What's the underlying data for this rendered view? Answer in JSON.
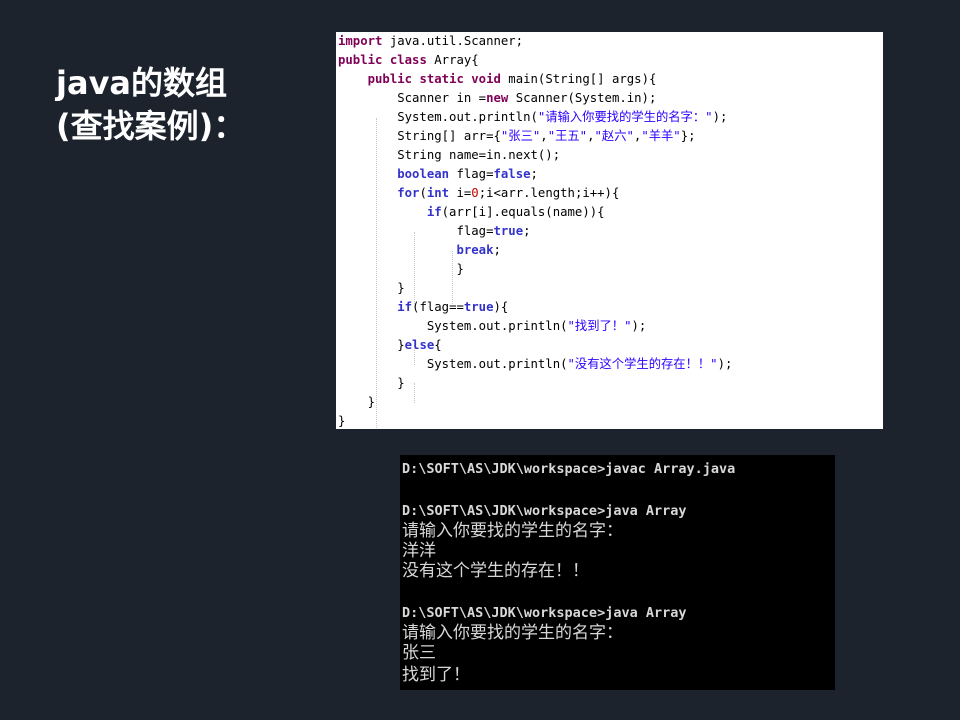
{
  "slide": {
    "title_line1": "java的数组",
    "title_line2": "(查找案例)："
  },
  "code": {
    "lines": [
      [
        {
          "t": "import",
          "c": "kw"
        },
        {
          "t": " java.util.Scanner;",
          "c": "pl"
        }
      ],
      [
        {
          "t": "public",
          "c": "kw"
        },
        {
          "t": " ",
          "c": "pl"
        },
        {
          "t": "class",
          "c": "kw"
        },
        {
          "t": " Array{",
          "c": "pl"
        }
      ],
      [
        {
          "t": "    ",
          "c": "pl"
        },
        {
          "t": "public",
          "c": "kw"
        },
        {
          "t": " ",
          "c": "pl"
        },
        {
          "t": "static",
          "c": "kw"
        },
        {
          "t": " ",
          "c": "pl"
        },
        {
          "t": "void",
          "c": "kw"
        },
        {
          "t": " main(String[] args){",
          "c": "pl"
        }
      ],
      [
        {
          "t": "        Scanner in =",
          "c": "pl"
        },
        {
          "t": "new",
          "c": "kw"
        },
        {
          "t": " Scanner(System.in);",
          "c": "pl"
        }
      ],
      [
        {
          "t": "        System.out.println(",
          "c": "pl"
        },
        {
          "t": "\"请输入你要找的学生的名字：\"",
          "c": "str"
        },
        {
          "t": ");",
          "c": "pl"
        }
      ],
      [
        {
          "t": "        String[] arr={",
          "c": "pl"
        },
        {
          "t": "\"张三\"",
          "c": "str"
        },
        {
          "t": ",",
          "c": "pl"
        },
        {
          "t": "\"王五\"",
          "c": "str"
        },
        {
          "t": ",",
          "c": "pl"
        },
        {
          "t": "\"赵六\"",
          "c": "str"
        },
        {
          "t": ",",
          "c": "pl"
        },
        {
          "t": "\"羊羊\"",
          "c": "str"
        },
        {
          "t": "};",
          "c": "pl"
        }
      ],
      [
        {
          "t": "        String name=in.next();",
          "c": "pl"
        }
      ],
      [
        {
          "t": "        ",
          "c": "pl"
        },
        {
          "t": "boolean",
          "c": "kb"
        },
        {
          "t": " flag=",
          "c": "pl"
        },
        {
          "t": "false",
          "c": "kb"
        },
        {
          "t": ";",
          "c": "pl"
        }
      ],
      [
        {
          "t": "        ",
          "c": "pl"
        },
        {
          "t": "for",
          "c": "kb"
        },
        {
          "t": "(",
          "c": "pl"
        },
        {
          "t": "int",
          "c": "kb"
        },
        {
          "t": " i=",
          "c": "pl"
        },
        {
          "t": "0",
          "c": "num"
        },
        {
          "t": ";i<arr.length;i++){",
          "c": "pl"
        }
      ],
      [
        {
          "t": "            ",
          "c": "pl"
        },
        {
          "t": "if",
          "c": "kb"
        },
        {
          "t": "(arr[i].equals(name)){",
          "c": "pl"
        }
      ],
      [
        {
          "t": "                flag=",
          "c": "pl"
        },
        {
          "t": "true",
          "c": "kb"
        },
        {
          "t": ";",
          "c": "pl"
        }
      ],
      [
        {
          "t": "                ",
          "c": "pl"
        },
        {
          "t": "break",
          "c": "kb"
        },
        {
          "t": ";",
          "c": "pl"
        }
      ],
      [
        {
          "t": "                }",
          "c": "pl"
        }
      ],
      [
        {
          "t": "        }",
          "c": "pl"
        }
      ],
      [
        {
          "t": "        ",
          "c": "pl"
        },
        {
          "t": "if",
          "c": "kb"
        },
        {
          "t": "(flag==",
          "c": "pl"
        },
        {
          "t": "true",
          "c": "kb"
        },
        {
          "t": "){",
          "c": "pl"
        }
      ],
      [
        {
          "t": "            System.out.println(",
          "c": "pl"
        },
        {
          "t": "\"找到了！\"",
          "c": "str"
        },
        {
          "t": ");",
          "c": "pl"
        }
      ],
      [
        {
          "t": "        }",
          "c": "pl"
        },
        {
          "t": "else",
          "c": "kb"
        },
        {
          "t": "{",
          "c": "pl"
        }
      ],
      [
        {
          "t": "            System.out.println(",
          "c": "pl"
        },
        {
          "t": "\"没有这个学生的存在！！\"",
          "c": "str"
        },
        {
          "t": ");",
          "c": "pl"
        }
      ],
      [
        {
          "t": "        }",
          "c": "pl"
        }
      ],
      [
        {
          "t": "    }",
          "c": "pl"
        }
      ],
      [
        {
          "t": "}",
          "c": "pl"
        }
      ]
    ]
  },
  "console": {
    "lines": [
      {
        "text": "D:\\SOFT\\AS\\JDK\\workspace>javac Array.java",
        "kind": "cmd"
      },
      {
        "text": "",
        "kind": "cmd"
      },
      {
        "text": "D:\\SOFT\\AS\\JDK\\workspace>java Array",
        "kind": "cmd"
      },
      {
        "text": "请输入你要找的学生的名字：",
        "kind": "txt"
      },
      {
        "text": "洋洋",
        "kind": "txt"
      },
      {
        "text": "没有这个学生的存在！！",
        "kind": "txt"
      },
      {
        "text": "",
        "kind": "cmd"
      },
      {
        "text": "D:\\SOFT\\AS\\JDK\\workspace>java Array",
        "kind": "cmd"
      },
      {
        "text": "请输入你要找的学生的名字：",
        "kind": "txt"
      },
      {
        "text": "张三",
        "kind": "txt"
      },
      {
        "text": "找到了！",
        "kind": "txt"
      }
    ]
  }
}
